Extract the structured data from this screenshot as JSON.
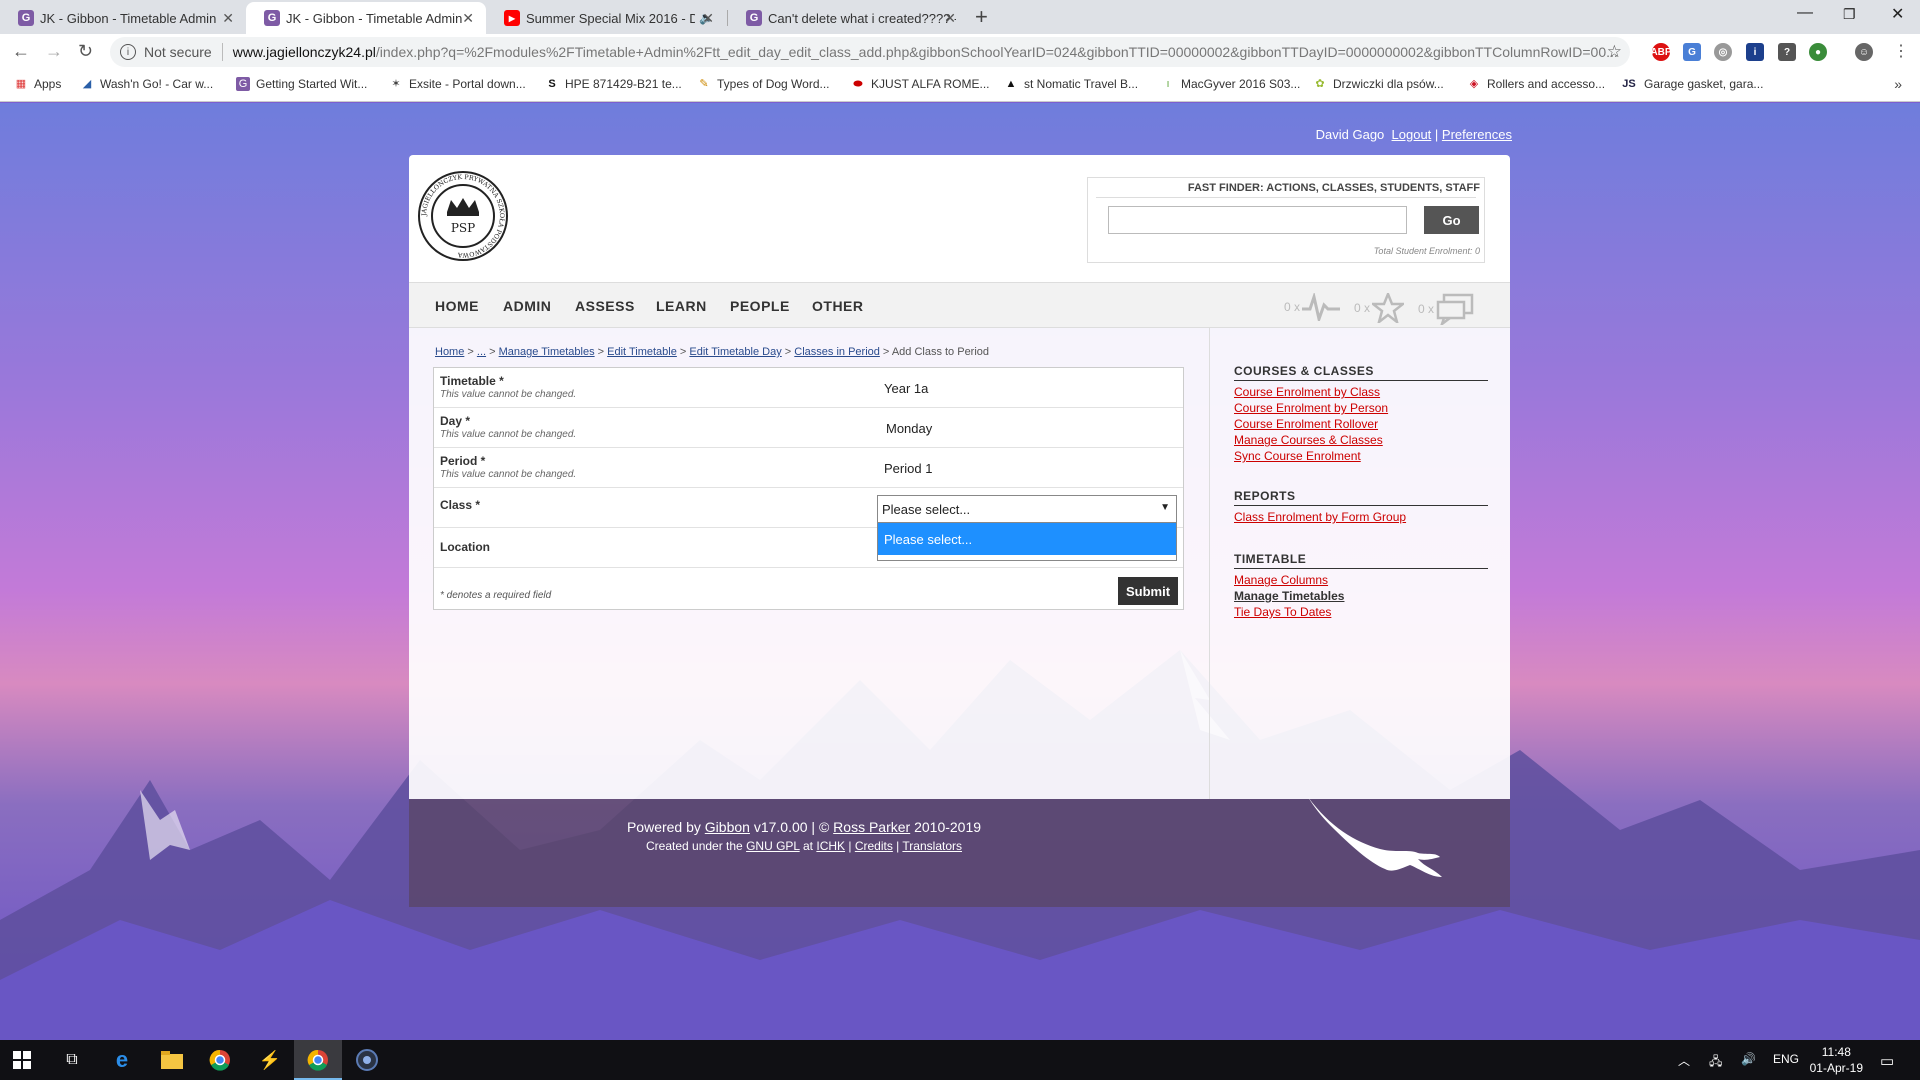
{
  "browser": {
    "tabs": [
      {
        "title": "JK - Gibbon - Timetable Admin",
        "favicon": "G",
        "active": false
      },
      {
        "title": "JK - Gibbon - Timetable Admin",
        "favicon": "G",
        "active": true
      },
      {
        "title": "Summer Special Mix 2016 - D",
        "favicon": "▶",
        "active": false
      },
      {
        "title": "Can't delete what i created???? -",
        "favicon": "G",
        "active": false
      }
    ],
    "not_secure": "Not secure",
    "url_host": "www.jagiellonczyk24.pl",
    "url_rest": "/index.php?q=%2Fmodules%2FTimetable+Admin%2Ftt_edit_day_edit_class_add.php&gibbonSchoolYearID=024&gibbonTTID=00000002&gibbonTTDayID=0000000002&gibbonTTColumnRowID=00...",
    "bookmarks": [
      {
        "label": "Apps",
        "icon": "apps-icon"
      },
      {
        "label": "Wash'n Go! - Car w...",
        "icon": "shoe-icon"
      },
      {
        "label": "Getting Started Wit...",
        "icon": "gibbon-icon"
      },
      {
        "label": "Exsite - Portal down...",
        "icon": "star-icon"
      },
      {
        "label": "HPE 871429-B21 te...",
        "icon": "s-icon"
      },
      {
        "label": "Types of Dog Word...",
        "icon": "pencil-icon"
      },
      {
        "label": "KJUST ALFA ROME...",
        "icon": "car-icon"
      },
      {
        "label": "st Nomatic Travel B...",
        "icon": "nomatic-icon"
      },
      {
        "label": "MacGyver 2016 S03...",
        "icon": "bookmark-icon"
      },
      {
        "label": "Drzwiczki dla psów...",
        "icon": "flower-icon"
      },
      {
        "label": "Rollers and accesso...",
        "icon": "diamond-icon"
      },
      {
        "label": "Garage gasket, gara...",
        "icon": "js-icon"
      }
    ]
  },
  "userbar": {
    "name": "David Gago",
    "logout": "Logout",
    "preferences": "Preferences"
  },
  "logo": {
    "center": "PSP",
    "ring": "JAGIELLONCZYK PRYWATNA SZKOŁA PODSTAWOWA"
  },
  "finder": {
    "title": "FAST FINDER: ACTIONS, CLASSES, STUDENTS, STAFF",
    "go": "Go",
    "total": "Total Student Enrolment: 0"
  },
  "menu": [
    "HOME",
    "ADMIN",
    "ASSESS",
    "LEARN",
    "PEOPLE",
    "OTHER"
  ],
  "notifications": {
    "alarms": "0 x",
    "likes": "0 x",
    "messages": "0 x"
  },
  "breadcrumb": {
    "links": [
      "Home",
      "...",
      "Manage Timetables",
      "Edit Timetable",
      "Edit Timetable Day",
      "Classes in Period"
    ],
    "current": "Add Class to Period"
  },
  "form": {
    "rows": [
      {
        "label": "Timetable *",
        "desc": "This value cannot be changed.",
        "value": "Year 1a"
      },
      {
        "label": "Day *",
        "desc": "This value cannot be changed.",
        "value": "Monday"
      },
      {
        "label": "Period *",
        "desc": "This value cannot be changed.",
        "value": "Period 1"
      }
    ],
    "class_label": "Class *",
    "class_selected": "Please select...",
    "class_options": [
      "Please select..."
    ],
    "location_label": "Location",
    "required_note": "* denotes a required field",
    "submit": "Submit"
  },
  "sidebar": {
    "sections": [
      {
        "title": "COURSES & CLASSES",
        "links": [
          "Course Enrolment by Class",
          "Course Enrolment by Person",
          "Course Enrolment Rollover",
          "Manage Courses & Classes",
          "Sync Course Enrolment"
        ]
      },
      {
        "title": "REPORTS",
        "links": [
          "Class Enrolment by Form Group"
        ]
      },
      {
        "title": "TIMETABLE",
        "links": [
          "Manage Columns",
          "Manage Timetables",
          "Tie Days To Dates"
        ]
      }
    ]
  },
  "footer": {
    "powered": "Powered by",
    "gibbon": "Gibbon",
    "version": "v17.0.00 | ©",
    "author": "Ross Parker",
    "years": "2010-2019",
    "created": "Created under the",
    "gpl": "GNU GPL",
    "at": "at",
    "ichk": "ICHK",
    "credits": "Credits",
    "translators": "Translators"
  },
  "taskbar": {
    "lang": "ENG",
    "time": "11:48",
    "date": "01-Apr-19"
  },
  "colors": {
    "link_red": "#cc0000",
    "highlight_blue": "#1e90ff",
    "button_dark": "#333333"
  }
}
